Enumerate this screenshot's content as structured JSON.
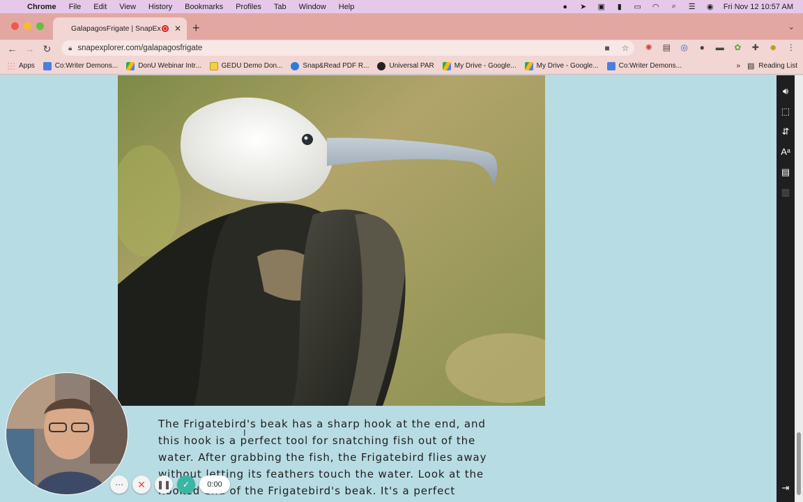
{
  "menubar": {
    "app": "Chrome",
    "items": [
      "File",
      "Edit",
      "View",
      "History",
      "Bookmarks",
      "Profiles",
      "Tab",
      "Window",
      "Help"
    ],
    "clock": "Fri Nov 12  10:57 AM"
  },
  "tab": {
    "title": "GalapagosFrigate | SnapEx",
    "close": "✕",
    "new_tab": "+"
  },
  "toolbar": {
    "url": "snapexplorer.com/galapagosfrigate"
  },
  "bookmarks": {
    "items": [
      {
        "label": "Apps"
      },
      {
        "label": "Co:Writer Demons..."
      },
      {
        "label": "DonU Webinar Intr..."
      },
      {
        "label": "GEDU Demo Don..."
      },
      {
        "label": "Snap&Read PDF R..."
      },
      {
        "label": "Universal PAR"
      },
      {
        "label": "My Drive - Google..."
      },
      {
        "label": "My Drive - Google..."
      },
      {
        "label": "Co:Writer Demons..."
      }
    ],
    "more": "»",
    "reading_list": "Reading List"
  },
  "article": {
    "lines": [
      "The Frigatebird's beak has a sharp hook at the end, and",
      "this hook is a perfect tool for snatching fish out of the",
      "water. After grabbing the fish, the Frigatebird flies away",
      "without letting its feathers touch the water.  Look at the",
      "hooked end of the Frigatebird's beak. It's a perfect"
    ]
  },
  "recorder": {
    "time": "0:00"
  },
  "colors": {
    "page_bg": "#b8dce3",
    "menubar_bg": "#e6c8e8",
    "tabstrip_bg": "#e3a7a2",
    "toolbar_bg": "#f2d6d3",
    "recorder_accent": "#39b7a4"
  },
  "icons": {
    "apple": "apple-icon",
    "sidebar_tools": [
      "speaker-icon",
      "selection-icon",
      "translate-icon",
      "text-style-icon",
      "mask-icon",
      "dictionary-icon",
      "exit-icon"
    ]
  }
}
